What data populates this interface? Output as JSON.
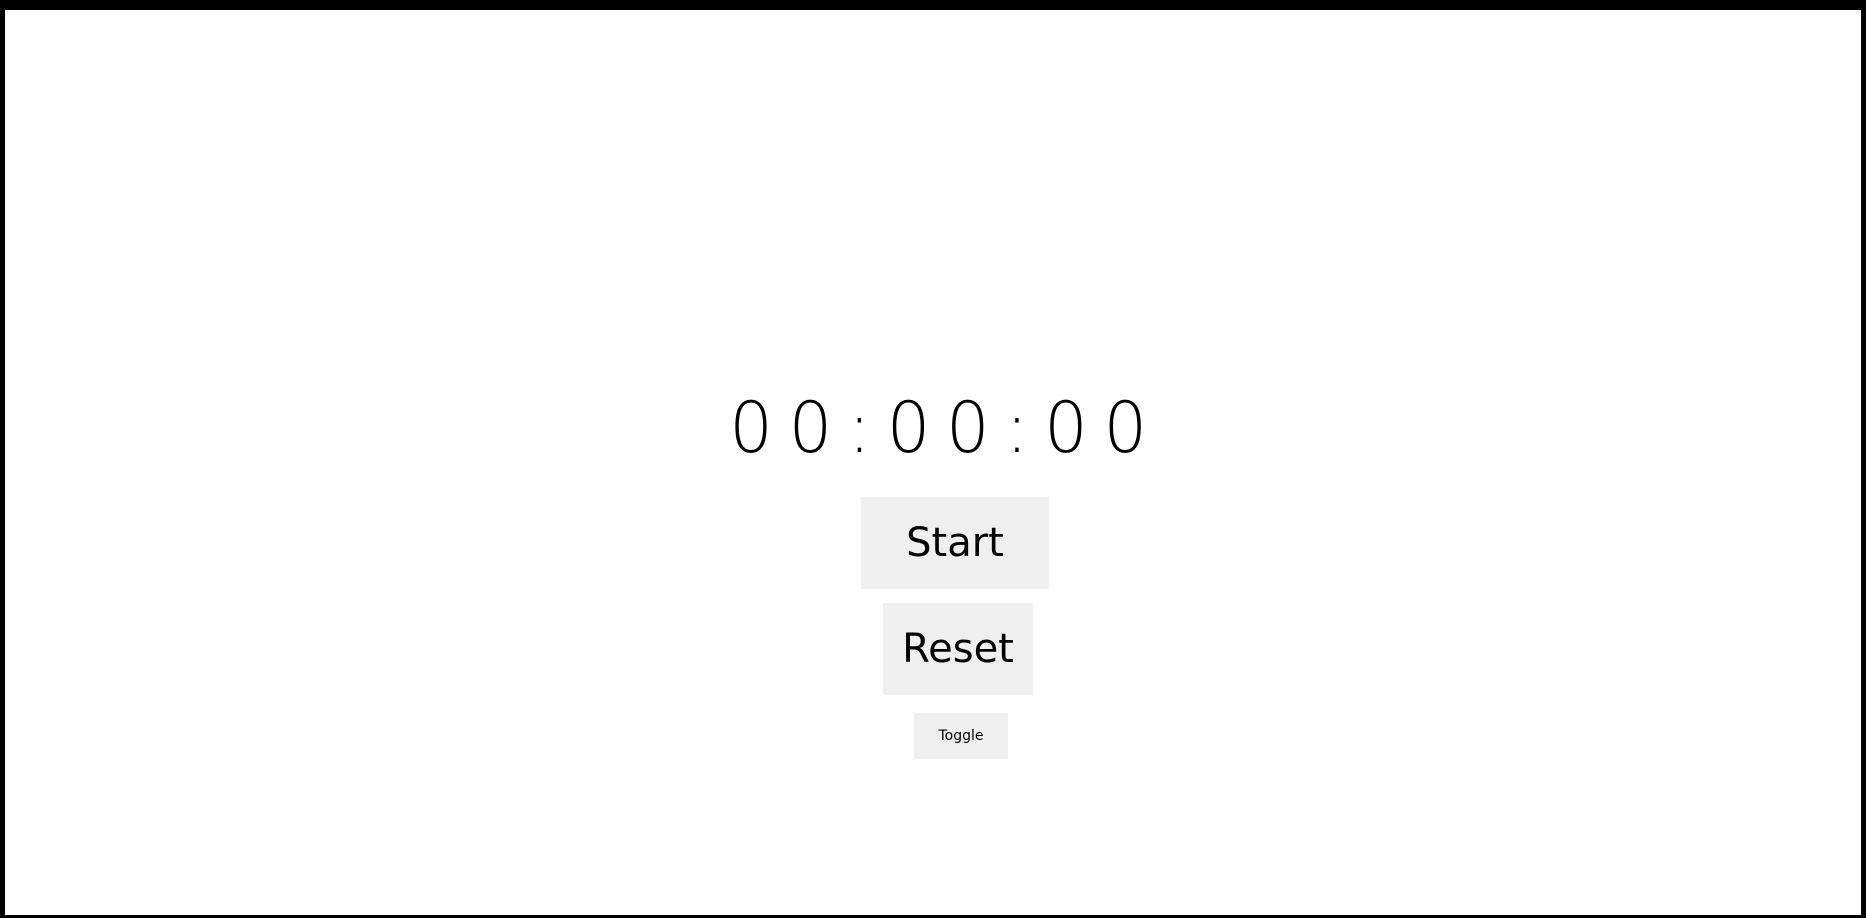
{
  "timer": {
    "display": "00:00:00"
  },
  "buttons": {
    "start_label": "Start",
    "reset_label": "Reset",
    "toggle_label": "Toggle"
  },
  "colors": {
    "background": "#ffffff",
    "frame": "#000000",
    "button_bg": "#efefef",
    "text": "#000000"
  }
}
